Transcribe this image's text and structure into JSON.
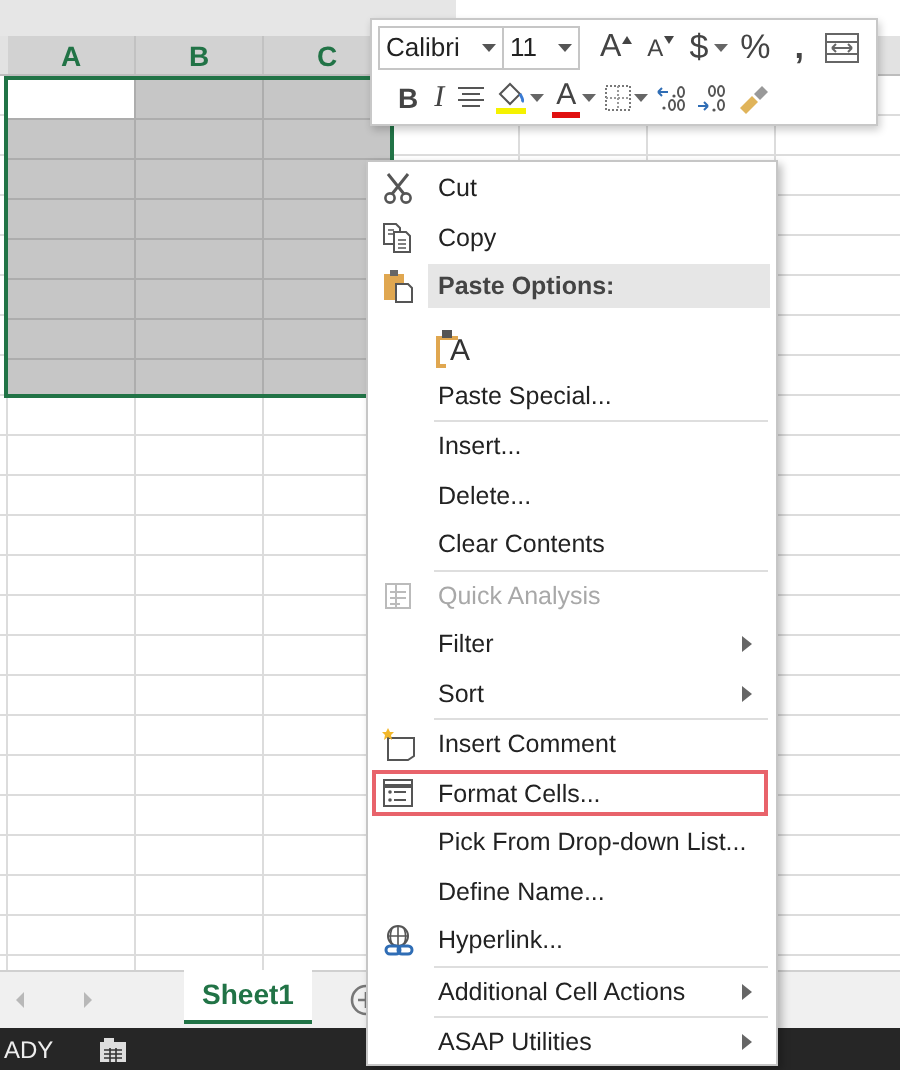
{
  "column_headers": [
    {
      "label": "A"
    },
    {
      "label": "B"
    },
    {
      "label": "C"
    }
  ],
  "mini_toolbar": {
    "font": {
      "value": "Calibri"
    },
    "size": {
      "value": "11"
    },
    "grow_font": "A",
    "shrink_font": "A",
    "currency": "$",
    "percent": "%",
    "comma": ",",
    "bold": "B",
    "italic": "I",
    "font_color": "A"
  },
  "context_menu": {
    "items": [
      {
        "kind": "command",
        "label": "Cut",
        "disabled": false,
        "submenu": false,
        "highlighted": false
      },
      {
        "kind": "command",
        "label": "Copy",
        "disabled": false,
        "submenu": false,
        "highlighted": false
      },
      {
        "kind": "header",
        "label": "Paste Options:"
      },
      {
        "kind": "paste-option",
        "label": "A"
      },
      {
        "kind": "command",
        "label": "Paste Special...",
        "disabled": false,
        "submenu": false,
        "highlighted": false
      },
      {
        "kind": "separator"
      },
      {
        "kind": "command",
        "label": "Insert...",
        "disabled": false,
        "submenu": false,
        "highlighted": false
      },
      {
        "kind": "command",
        "label": "Delete...",
        "disabled": false,
        "submenu": false,
        "highlighted": false
      },
      {
        "kind": "command",
        "label": "Clear Contents",
        "disabled": false,
        "submenu": false,
        "highlighted": false
      },
      {
        "kind": "separator"
      },
      {
        "kind": "command",
        "label": "Quick Analysis",
        "disabled": true,
        "submenu": false,
        "highlighted": false
      },
      {
        "kind": "command",
        "label": "Filter",
        "disabled": false,
        "submenu": true,
        "highlighted": false
      },
      {
        "kind": "command",
        "label": "Sort",
        "disabled": false,
        "submenu": true,
        "highlighted": false
      },
      {
        "kind": "separator"
      },
      {
        "kind": "command",
        "label": "Insert Comment",
        "disabled": false,
        "submenu": false,
        "highlighted": false
      },
      {
        "kind": "command",
        "label": "Format Cells...",
        "disabled": false,
        "submenu": false,
        "highlighted": true
      },
      {
        "kind": "command",
        "label": "Pick From Drop-down List...",
        "disabled": false,
        "submenu": false,
        "highlighted": false
      },
      {
        "kind": "command",
        "label": "Define Name...",
        "disabled": false,
        "submenu": false,
        "highlighted": false
      },
      {
        "kind": "command",
        "label": "Hyperlink...",
        "disabled": false,
        "submenu": false,
        "highlighted": false
      },
      {
        "kind": "separator"
      },
      {
        "kind": "command",
        "label": "Additional Cell Actions",
        "disabled": false,
        "submenu": true,
        "highlighted": false
      },
      {
        "kind": "separator"
      },
      {
        "kind": "command",
        "label": "ASAP Utilities",
        "disabled": false,
        "submenu": true,
        "highlighted": false
      }
    ]
  },
  "sheet_tabs": [
    {
      "label": "Sheet1",
      "selected": true
    }
  ],
  "status_bar": {
    "mode": "ADY"
  }
}
